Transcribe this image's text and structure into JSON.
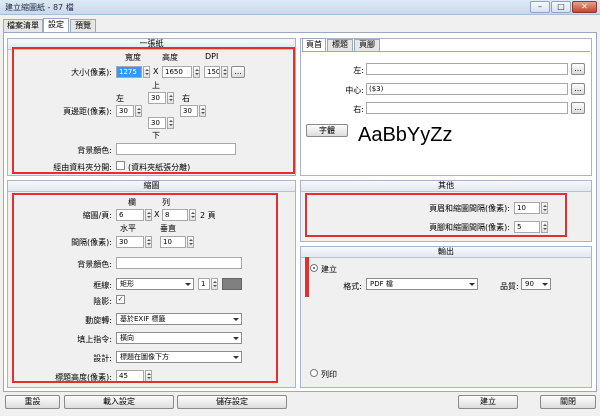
{
  "window": {
    "title": "建立縮圖紙 - 87 檔",
    "min": "–",
    "max": "□",
    "close": "✕"
  },
  "tabs": [
    "檔案清單",
    "設定",
    "預覽"
  ],
  "sheet": {
    "header": "一張紙",
    "width_label": "寬度",
    "height_label": "高度",
    "dpi_label": "DPI",
    "size_label": "大小(像素):",
    "width": "1275",
    "height": "1650",
    "dpi": "150",
    "x": "X",
    "margin_label": "頁邊距(像素):",
    "top_label": "上",
    "left_label": "左",
    "right_label": "右",
    "bottom_label": "下",
    "margin_top": "30",
    "margin_left": "30",
    "margin_right": "30",
    "margin_bottom": "30",
    "bg_label": "背景顏色:",
    "split_label": "經由資料夾分開:",
    "split_text": "(資料夾紙張分離)",
    "dots": "..."
  },
  "header_footer": {
    "tabs": [
      "頁首",
      "標題",
      "頁腳"
    ],
    "left_label": "左:",
    "center_label": "中心:",
    "center_value": "($3)",
    "right_label": "右:",
    "font_button": "字體",
    "preview": "AaBbYyZz",
    "dots": "..."
  },
  "thumb": {
    "header": "縮圖",
    "rows_label": "欄",
    "cols_label": "列",
    "per_page_label": "縮圖/頁:",
    "rows": "6",
    "x": "X",
    "cols": "8",
    "pages": "2 頁",
    "horiz_label": "水平",
    "vert_label": "垂直",
    "spacing_label": "間隔(像素):",
    "horiz": "30",
    "vert": "10",
    "bg_label": "背景顏色:",
    "border_label": "框線:",
    "border_value": "矩形",
    "border_width": "1",
    "shadow_label": "陰影:",
    "rotate_label": "動旋轉:",
    "rotate_value": "基於EXIF 標籤",
    "fill_label": "填上指令:",
    "fill_value": "橫向",
    "design_label": "設計:",
    "design_value": "標題在圖像下方",
    "title_height_label": "標題高度(像素):",
    "title_height": "45"
  },
  "other": {
    "header": "其他",
    "header_gap_label": "頁眉和縮圖間隔(像素):",
    "header_gap": "10",
    "footer_gap_label": "頁腳和縮圖間隔(像素):",
    "footer_gap": "5"
  },
  "output": {
    "header": "輸出",
    "create_label": "建立",
    "format_label": "格式:",
    "format_value": "PDF 檔",
    "quality_label": "品質:",
    "quality_value": "90",
    "print_label": "列印"
  },
  "footer": {
    "reset": "重設",
    "load": "載入設定",
    "save": "儲存設定",
    "build": "建立",
    "close": "關閉"
  },
  "colors": {
    "highlight": "#e03030",
    "selection": "#3399ff"
  }
}
